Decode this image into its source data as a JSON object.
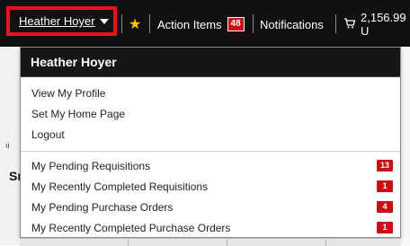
{
  "topbar": {
    "user_name": "Heather Hoyer",
    "star_icon": "star-icon",
    "action_items_label": "Action Items",
    "action_items_count": "48",
    "notifications_label": "Notifications",
    "cart_amount": "2,156.99 U"
  },
  "background": {
    "fragment_1": "ıi",
    "fragment_2": "Sı"
  },
  "dropdown": {
    "header": "Heather Hoyer",
    "profile_items": [
      {
        "label": "View My Profile"
      },
      {
        "label": "Set My Home Page"
      },
      {
        "label": "Logout"
      }
    ],
    "document_items": [
      {
        "label": "My Pending Requisitions",
        "count": "13"
      },
      {
        "label": "My Recently Completed Requisitions",
        "count": "1"
      },
      {
        "label": "My Pending Purchase Orders",
        "count": "4"
      },
      {
        "label": "My Recently Completed Purchase Orders",
        "count": "1"
      }
    ]
  },
  "colors": {
    "bar_background": "#111111",
    "highlight_border": "#e8141c",
    "badge_red": "#c90e16",
    "star_yellow": "#f5c400"
  }
}
